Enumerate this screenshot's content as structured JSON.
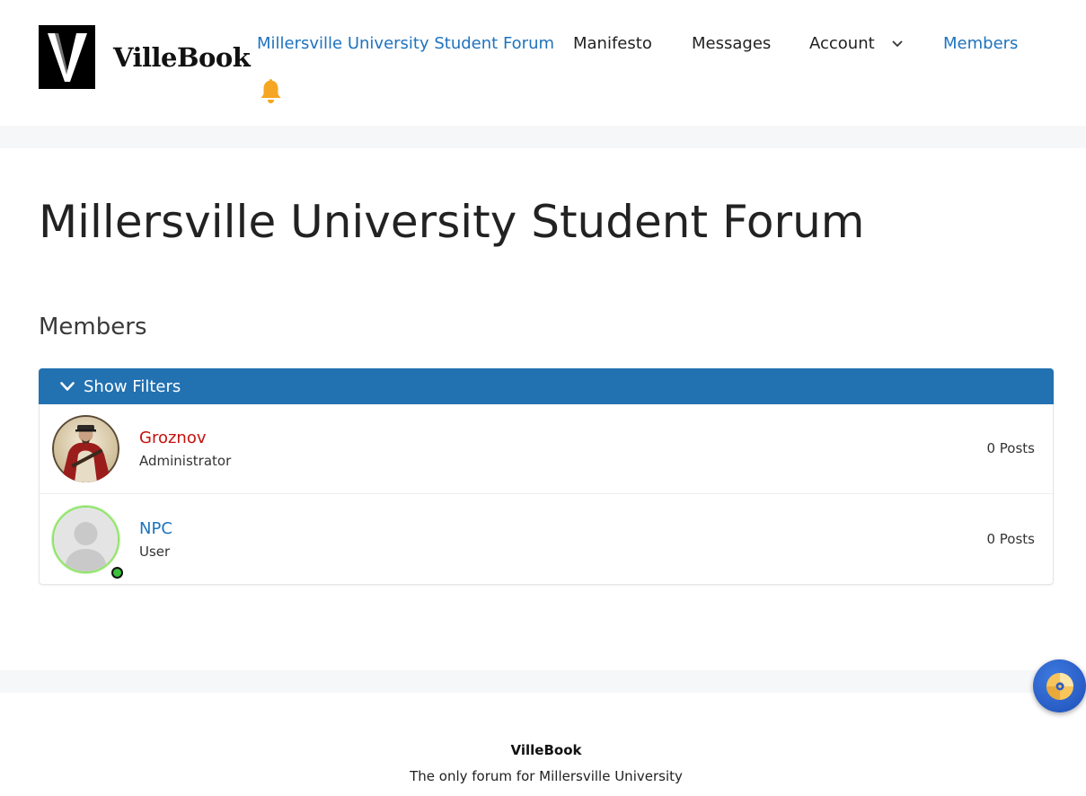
{
  "brand": {
    "logo_letter": "V",
    "name": "VilleBook"
  },
  "nav": {
    "forum": "Millersville University Student Forum",
    "manifesto": "Manifesto",
    "messages": "Messages",
    "account": "Account",
    "members": "Members"
  },
  "icons": {
    "notification": "bell-icon",
    "account_dropdown": "chevron-down-icon",
    "filters_toggle": "chevron-down-icon",
    "fab": "disc-icon"
  },
  "page": {
    "title": "Millersville University Student Forum",
    "section": "Members"
  },
  "filters": {
    "label": "Show Filters"
  },
  "members": [
    {
      "name": "Groznov",
      "role": "Administrator",
      "posts": "0 Posts",
      "online": false
    },
    {
      "name": "NPC",
      "role": "User",
      "posts": "0 Posts",
      "online": true
    }
  ],
  "footer": {
    "name": "VilleBook",
    "tagline": "The only forum for Millersville University"
  },
  "colors": {
    "accent": "#1e73be",
    "filter_bar": "#2271b1",
    "admin_name": "#c4120f",
    "bell": "#f5a623",
    "online": "#3ac13a"
  }
}
